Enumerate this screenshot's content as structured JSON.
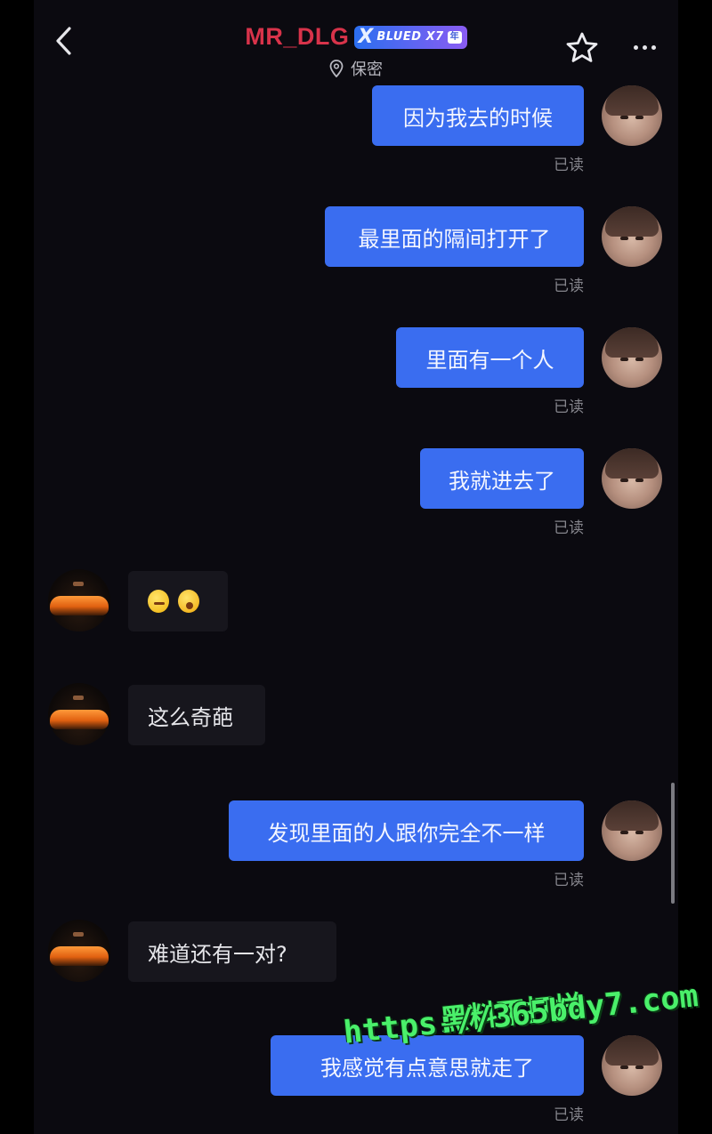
{
  "header": {
    "username": "MR_DLG",
    "badge_x": "X",
    "badge_text": "BLUED X7",
    "badge_mark": "年",
    "location": "保密"
  },
  "messages": [
    {
      "side": "out",
      "text": "因为我去的时候",
      "status": "已读"
    },
    {
      "side": "out",
      "text": "最里面的隔间打开了",
      "status": "已读"
    },
    {
      "side": "out",
      "text": "里面有一个人",
      "status": "已读"
    },
    {
      "side": "out",
      "text": "我就进去了",
      "status": "已读"
    },
    {
      "side": "in",
      "emojis": [
        "dizzy-face-emoji",
        "astonished-face-emoji"
      ]
    },
    {
      "side": "in",
      "text": "这么奇葩"
    },
    {
      "side": "out",
      "text": "发现里面的人跟你完全不一样",
      "status": "已读"
    },
    {
      "side": "in",
      "text": "难道还有一对?"
    },
    {
      "side": "out",
      "text": "我感觉有点意思就走了",
      "status": "已读"
    }
  ],
  "watermark": {
    "line1": "黑料不打烊",
    "line2": "https://365bdy7.com"
  },
  "colors": {
    "username": "#d8334a",
    "outgoing_bubble": "#3a6df0",
    "incoming_bubble": "#17161d",
    "background": "#0b0a10",
    "watermark": "#4af06a"
  }
}
